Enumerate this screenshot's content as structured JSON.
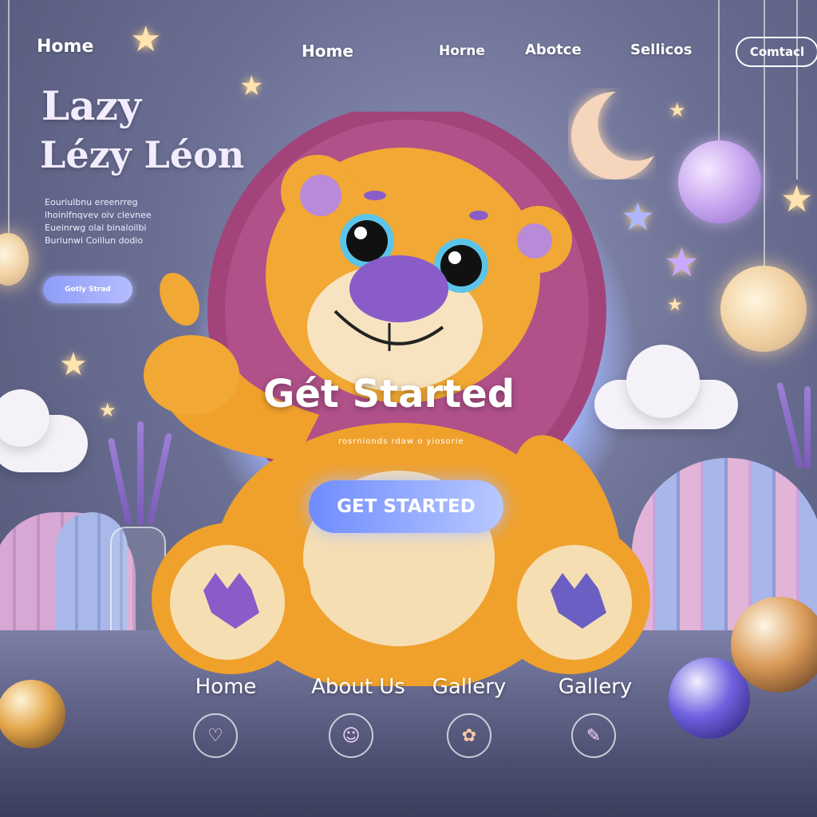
{
  "header": {
    "brand": "Home",
    "nav": [
      "Home",
      "Horne",
      "Abotce",
      "Sellicos"
    ],
    "contact": "Comtacl"
  },
  "hero": {
    "title_line1": "Lazy",
    "title_line2": "Lézy Léon",
    "body_lines": [
      "Eouriulbnu ereenrreg",
      "lhoinlfnqvev oiv clevnee",
      "Eueinrwg olai binaloilbi",
      "Buriunwi Coillun dodio"
    ],
    "small_button": "Gotly Strad"
  },
  "center": {
    "heading": "Gét Started",
    "tagline": "rosrnionds rdaw o yiosorie",
    "cta": "GET STARTED"
  },
  "bottom_nav": {
    "items": [
      {
        "label": "Home",
        "icon": "heart-scribble-icon"
      },
      {
        "label": "About Us",
        "icon": "face-scribble-icon"
      },
      {
        "label": "Gallery",
        "icon": "flower-scribble-icon"
      },
      {
        "label": "Gallery",
        "icon": "book-scribble-icon"
      }
    ]
  },
  "colors": {
    "background": "#6b6f93",
    "lion_body": "#f3a62e",
    "lion_mane": "#a2437a",
    "lion_nose": "#8a5cc8",
    "cta_start": "#6f8cff",
    "cta_end": "#b8c8ff"
  }
}
